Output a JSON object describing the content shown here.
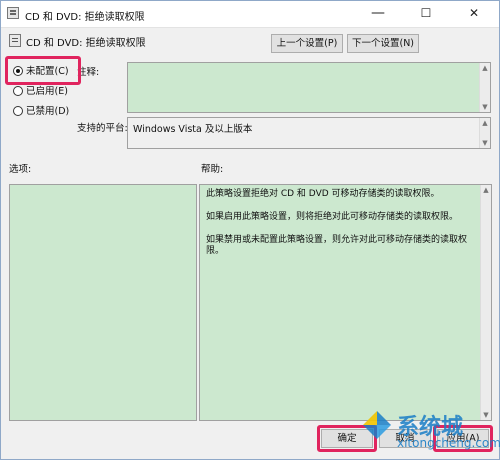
{
  "window": {
    "title": "CD 和 DVD: 拒绝读取权限",
    "minimize_glyph": "—",
    "maximize_glyph": "☐",
    "close_glyph": "✕"
  },
  "header": {
    "policy_name": "CD 和 DVD: 拒绝读取权限",
    "prev_button": "上一个设置(P)",
    "next_button": "下一个设置(N)"
  },
  "options": {
    "not_configured": "未配置(C)",
    "enabled": "已启用(E)",
    "disabled": "已禁用(D)",
    "selected": "not_configured"
  },
  "comment": {
    "label": "注释:",
    "value": ""
  },
  "platform": {
    "label": "支持的平台:",
    "value": "Windows Vista 及以上版本"
  },
  "sections": {
    "options_label": "选项:",
    "help_label": "帮助:"
  },
  "help": {
    "paragraphs": [
      "此策略设置拒绝对 CD 和 DVD 可移动存储类的读取权限。",
      "如果启用此策略设置，则将拒绝对此可移动存储类的读取权限。",
      "如果禁用或未配置此策略设置，则允许对此可移动存储类的读取权限。"
    ]
  },
  "footer": {
    "ok": "确定",
    "cancel": "取消",
    "apply": "应用(A)"
  },
  "watermark": {
    "brand": "系统城",
    "url": "xitongcheng.com"
  },
  "colors": {
    "accent_highlight": "#e0245e",
    "field_green": "#cce8cf"
  }
}
